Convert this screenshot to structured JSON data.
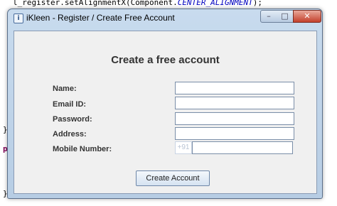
{
  "editor": {
    "line1_prefix": "l_register.setAlignmentX(Component.",
    "line1_constant": "CENTER_ALIGNMENT",
    "line1_suffix": ");",
    "line2_faint": "l_register.setAlignmentX(Component.CENTER_ALIGNMENT);",
    "brace": "}",
    "keyword_stub": "pu",
    "brace_bottom": "}"
  },
  "window": {
    "title": "iKleen - Register / Create Free Account",
    "icon_glyph": "i",
    "minimize_glyph": "–",
    "maximize_glyph": "□",
    "close_glyph": "✕"
  },
  "form": {
    "heading": "Create a free account",
    "fields": {
      "name_label": "Name:",
      "email_label": "Email ID:",
      "password_label": "Password:",
      "address_label": "Address:",
      "mobile_label": "Mobile Number:"
    },
    "values": {
      "name": "",
      "email": "",
      "password": "",
      "address": "",
      "mobile": ""
    },
    "mobile_prefix": "+91",
    "submit_label": "Create Account"
  }
}
